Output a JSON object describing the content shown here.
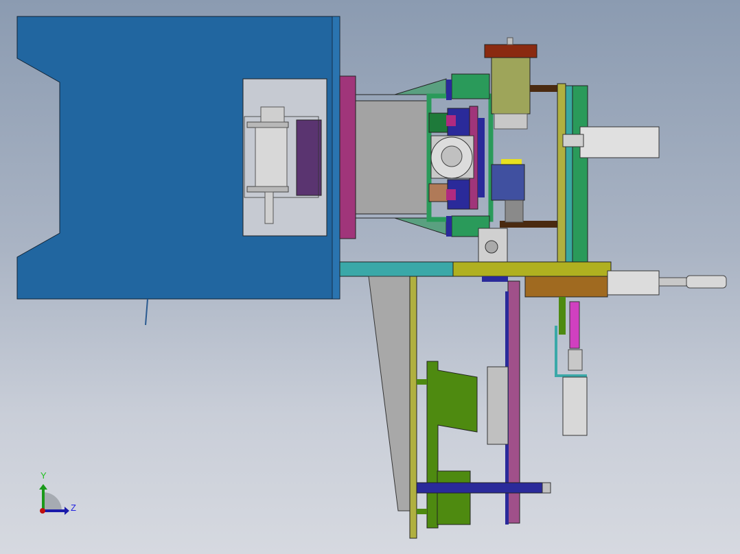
{
  "triad": {
    "y_label": "Y",
    "z_label": "Z"
  },
  "colors": {
    "frame_blue": "#2166a0",
    "magenta": "#a0357a",
    "green": "#2a9a5a",
    "olive": "#9ea55a",
    "navy": "#2a2a9a",
    "leaf_green": "#4e8a10",
    "purple": "#a0508a",
    "cap_red": "#8a2a10"
  }
}
